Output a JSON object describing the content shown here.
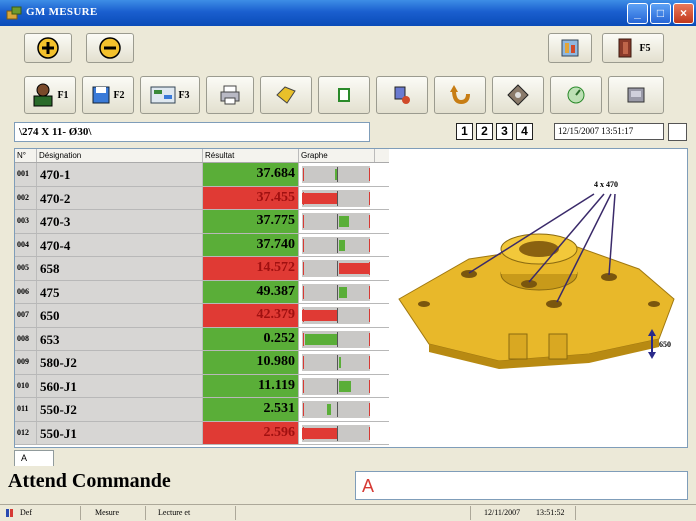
{
  "window": {
    "title": "GM MESURE",
    "min": "_",
    "max": "□",
    "close": "×"
  },
  "toolbar1": {
    "f5_label": "F5"
  },
  "toolbar2": {
    "f1": "F1",
    "f2": "F2",
    "f3": "F3"
  },
  "address": {
    "value": "\\274 X 11- Ø30\\"
  },
  "counters": [
    "1",
    "2",
    "3",
    "4"
  ],
  "datetime": "12/15/2007 13:51:17",
  "grid": {
    "headers": {
      "num": "N°",
      "designation": "Désignation",
      "result": "Résultat",
      "graph": "Graphe"
    },
    "rows": [
      {
        "num": "001",
        "designation": "470-1",
        "result": "37.684",
        "status": "ok"
      },
      {
        "num": "002",
        "designation": "470-2",
        "result": "37.455",
        "status": "nok"
      },
      {
        "num": "003",
        "designation": "470-3",
        "result": "37.775",
        "status": "ok"
      },
      {
        "num": "004",
        "designation": "470-4",
        "result": "37.740",
        "status": "ok"
      },
      {
        "num": "005",
        "designation": "658",
        "result": "14.572",
        "status": "nok"
      },
      {
        "num": "006",
        "designation": "475",
        "result": "49.387",
        "status": "ok"
      },
      {
        "num": "007",
        "designation": "650",
        "result": "42.379",
        "status": "nok"
      },
      {
        "num": "008",
        "designation": "653",
        "result": "0.252",
        "status": "ok"
      },
      {
        "num": "009",
        "designation": "580-J2",
        "result": "10.980",
        "status": "ok"
      },
      {
        "num": "010",
        "designation": "560-J1",
        "result": "11.119",
        "status": "ok"
      },
      {
        "num": "011",
        "designation": "550-J2",
        "result": "2.531",
        "status": "ok"
      },
      {
        "num": "012",
        "designation": "550-J1",
        "result": "2.596",
        "status": "nok"
      }
    ]
  },
  "drawing": {
    "callout1": "4 x 470",
    "callout2": "650"
  },
  "tab": {
    "label": "A"
  },
  "command": {
    "status": "Attend Commande",
    "input": "A"
  },
  "statusbar": {
    "def": "Def",
    "mesure": "Mesure",
    "lecture": "Lecture et",
    "date": "12/11/2007",
    "time": "13:51:52"
  },
  "colors": {
    "ok": "#5aae38",
    "nok": "#e03a34",
    "part": "#e8b82a",
    "titlebar": "#1a5fcf"
  }
}
